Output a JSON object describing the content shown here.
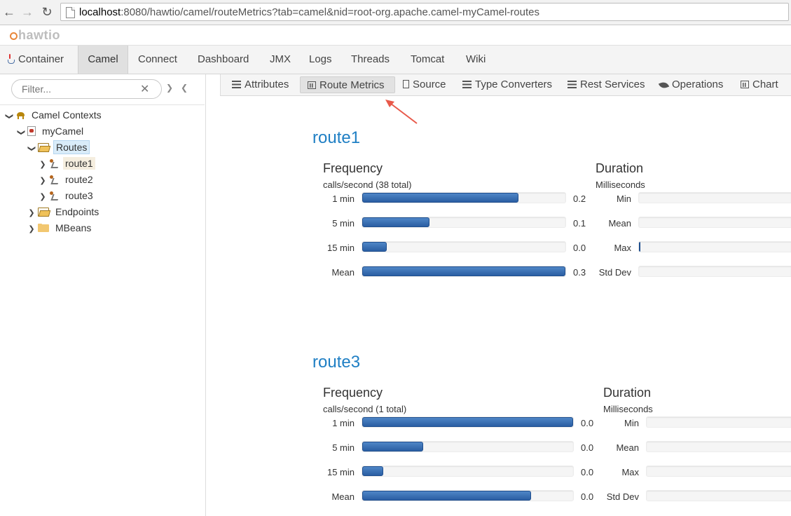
{
  "browser": {
    "url_host": "localhost",
    "url_rest": ":8080/hawtio/camel/routeMetrics?tab=camel&nid=root-org.apache.camel-myCamel-routes",
    "back_icon": "arrow-left-icon",
    "forward_icon": "arrow-right-icon",
    "reload_icon": "reload-icon"
  },
  "app": {
    "logo": "hawtio"
  },
  "main_nav": [
    {
      "label": "Container",
      "icon": "java-icon"
    },
    {
      "label": "Camel",
      "active": true
    },
    {
      "label": "Connect"
    },
    {
      "label": "Dashboard"
    },
    {
      "label": "JMX"
    },
    {
      "label": "Logs"
    },
    {
      "label": "Threads"
    },
    {
      "label": "Tomcat"
    },
    {
      "label": "Wiki"
    }
  ],
  "sidebar": {
    "filter_placeholder": "Filter...",
    "tree": [
      {
        "label": "Camel Contexts",
        "icon": "camel-icon",
        "expanded": true
      },
      {
        "label": "myCamel",
        "icon": "camel-context-icon",
        "expanded": true
      },
      {
        "label": "Routes",
        "icon": "folder-open-icon",
        "expanded": true,
        "selected": true
      },
      {
        "label": "route1",
        "icon": "route-icon"
      },
      {
        "label": "route2",
        "icon": "route-icon"
      },
      {
        "label": "route3",
        "icon": "route-icon"
      },
      {
        "label": "Endpoints",
        "icon": "folder-open-icon"
      },
      {
        "label": "MBeans",
        "icon": "folder-icon"
      }
    ]
  },
  "subtabs": [
    {
      "label": "Attributes",
      "icon": "list-icon"
    },
    {
      "label": "Route Metrics",
      "icon": "bar-chart-icon",
      "active": true
    },
    {
      "label": "Source",
      "icon": "file-icon"
    },
    {
      "label": "Type Converters",
      "icon": "list-icon"
    },
    {
      "label": "Rest Services",
      "icon": "list-icon"
    },
    {
      "label": "Operations",
      "icon": "leaf-icon"
    },
    {
      "label": "Chart",
      "icon": "bar-chart-icon"
    }
  ],
  "routes": [
    {
      "name": "route1",
      "frequency": {
        "title": "Frequency",
        "subtitle": "calls/second (38 total)",
        "rows": [
          {
            "label": "1 min",
            "value": "0.2",
            "fill": 0.77
          },
          {
            "label": "5 min",
            "value": "0.1",
            "fill": 0.33
          },
          {
            "label": "15 min",
            "value": "0.0",
            "fill": 0.12
          },
          {
            "label": "Mean",
            "value": "0.3",
            "fill": 1.0
          }
        ]
      },
      "duration": {
        "title": "Duration",
        "subtitle": "Milliseconds",
        "rows": [
          {
            "label": "Min",
            "fill": 0
          },
          {
            "label": "Mean",
            "fill": 0
          },
          {
            "label": "Max",
            "fill": 0.01
          },
          {
            "label": "Std Dev",
            "fill": 0
          }
        ]
      }
    },
    {
      "name": "route3",
      "frequency": {
        "title": "Frequency",
        "subtitle": "calls/second (1 total)",
        "rows": [
          {
            "label": "1 min",
            "value": "0.0",
            "fill": 1.0
          },
          {
            "label": "5 min",
            "value": "0.0",
            "fill": 0.29
          },
          {
            "label": "15 min",
            "value": "0.0",
            "fill": 0.1
          },
          {
            "label": "Mean",
            "value": "0.0",
            "fill": 0.8
          }
        ]
      },
      "duration": {
        "title": "Duration",
        "subtitle": "Milliseconds",
        "rows": [
          {
            "label": "Min",
            "fill": 0
          },
          {
            "label": "Mean",
            "fill": 0
          },
          {
            "label": "Max",
            "fill": 0
          },
          {
            "label": "Std Dev",
            "fill": 0
          }
        ]
      }
    }
  ],
  "colors": {
    "accent": "#1f7fc4",
    "bar": "#2a5ea3",
    "annotation_arrow": "#e8594a"
  }
}
